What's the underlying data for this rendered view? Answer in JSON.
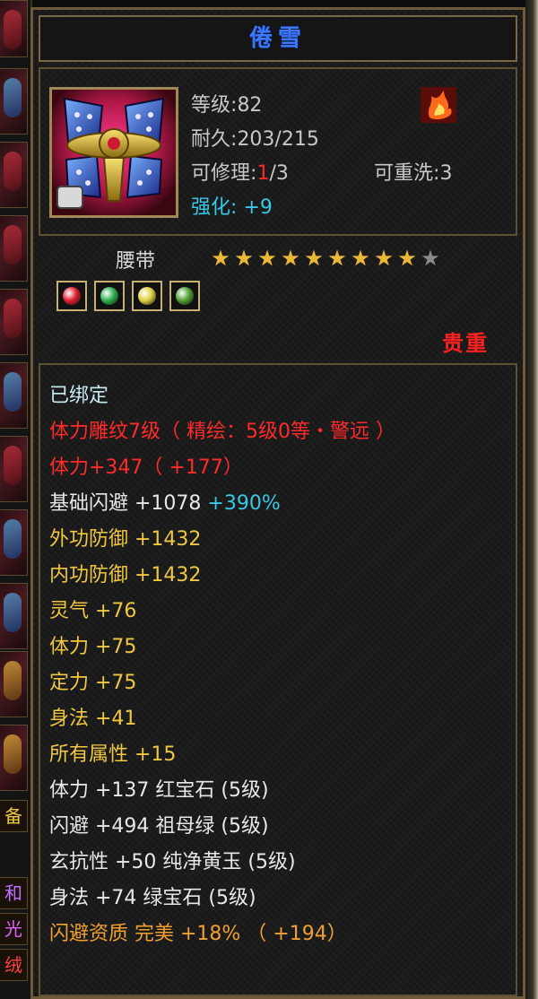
{
  "item": {
    "name": "倦雪",
    "type": "腰带",
    "quality_label": "贵重",
    "level_label": "等级",
    "level_value": "82",
    "durability_label": "耐久",
    "durability_value": "203/215",
    "repair_label": "可修理",
    "repair_current": "1",
    "repair_max": "/3",
    "rewash_label": "可重洗",
    "rewash_value": "3",
    "enhance_label": "强化",
    "enhance_value": "+9",
    "stars_total": 10,
    "stars_filled": 9,
    "gems": [
      {
        "name": "ruby-gem",
        "color": "#e02030"
      },
      {
        "name": "emerald-gem",
        "color": "#30b050"
      },
      {
        "name": "topaz-gem",
        "color": "#e0d040"
      },
      {
        "name": "green-gem",
        "color": "#50a030"
      }
    ]
  },
  "attributes": [
    {
      "text": "已绑定",
      "extra": "",
      "color": "bluewhite"
    },
    {
      "text": "体力雕纹7级（ 精绘：5级0等・警远 ）",
      "extra": "",
      "color": "red"
    },
    {
      "text": "体力+347（ +177）",
      "extra": "",
      "color": "red"
    },
    {
      "text": "基础闪避  +1078",
      "extra": "+390%",
      "color": "white"
    },
    {
      "text": "外功防御  +1432",
      "extra": "",
      "color": "yellow"
    },
    {
      "text": "内功防御  +1432",
      "extra": "",
      "color": "yellow"
    },
    {
      "text": "灵气  +76",
      "extra": "",
      "color": "yellow"
    },
    {
      "text": "体力  +75",
      "extra": "",
      "color": "yellow"
    },
    {
      "text": "定力  +75",
      "extra": "",
      "color": "yellow"
    },
    {
      "text": "身法  +41",
      "extra": "",
      "color": "yellow"
    },
    {
      "text": "所有属性  +15",
      "extra": "",
      "color": "yellow"
    },
    {
      "text": "体力  +137  红宝石 (5级)",
      "extra": "",
      "color": "white"
    },
    {
      "text": "闪避  +494  祖母绿 (5级)",
      "extra": "",
      "color": "white"
    },
    {
      "text": "玄抗性  +50  纯净黄玉 (5级)",
      "extra": "",
      "color": "white"
    },
    {
      "text": "身法  +74  绿宝石 (5级)",
      "extra": "",
      "color": "white"
    },
    {
      "text": "闪避资质   完美  +18%  （ +194）",
      "extra": "",
      "color": "orange"
    }
  ],
  "sidebar": {
    "labels": [
      "备",
      "和",
      "光",
      "绒"
    ]
  }
}
